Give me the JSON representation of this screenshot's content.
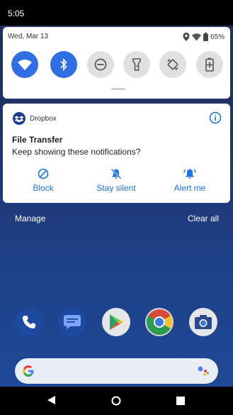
{
  "status_bar": {
    "time": "5:05"
  },
  "quick_settings": {
    "date": "Wed, Mar 13",
    "battery": "65%",
    "tiles": [
      {
        "name": "wifi-tile",
        "icon": "wifi-icon",
        "state": "on"
      },
      {
        "name": "bluetooth-tile",
        "icon": "bluetooth-icon",
        "state": "on"
      },
      {
        "name": "do-not-disturb-tile",
        "icon": "dnd-icon",
        "state": "off"
      },
      {
        "name": "flashlight-tile",
        "icon": "flashlight-icon",
        "state": "off"
      },
      {
        "name": "auto-rotate-tile",
        "icon": "rotate-icon",
        "state": "off"
      },
      {
        "name": "battery-saver-tile",
        "icon": "battery-saver-icon",
        "state": "off"
      }
    ]
  },
  "notification": {
    "app_name": "Dropbox",
    "title": "File Transfer",
    "text": "Keep showing these notifications?",
    "actions": {
      "block": "Block",
      "silent": "Stay silent",
      "alert": "Alert me"
    }
  },
  "shade_footer": {
    "manage": "Manage",
    "clear_all": "Clear all"
  },
  "home": {
    "dock_apps": [
      "phone-icon",
      "messages-icon",
      "play-store-icon",
      "chrome-icon",
      "camera-icon"
    ]
  },
  "colors": {
    "accent": "#1a73e8",
    "tile_on": "#2f6ee3"
  }
}
